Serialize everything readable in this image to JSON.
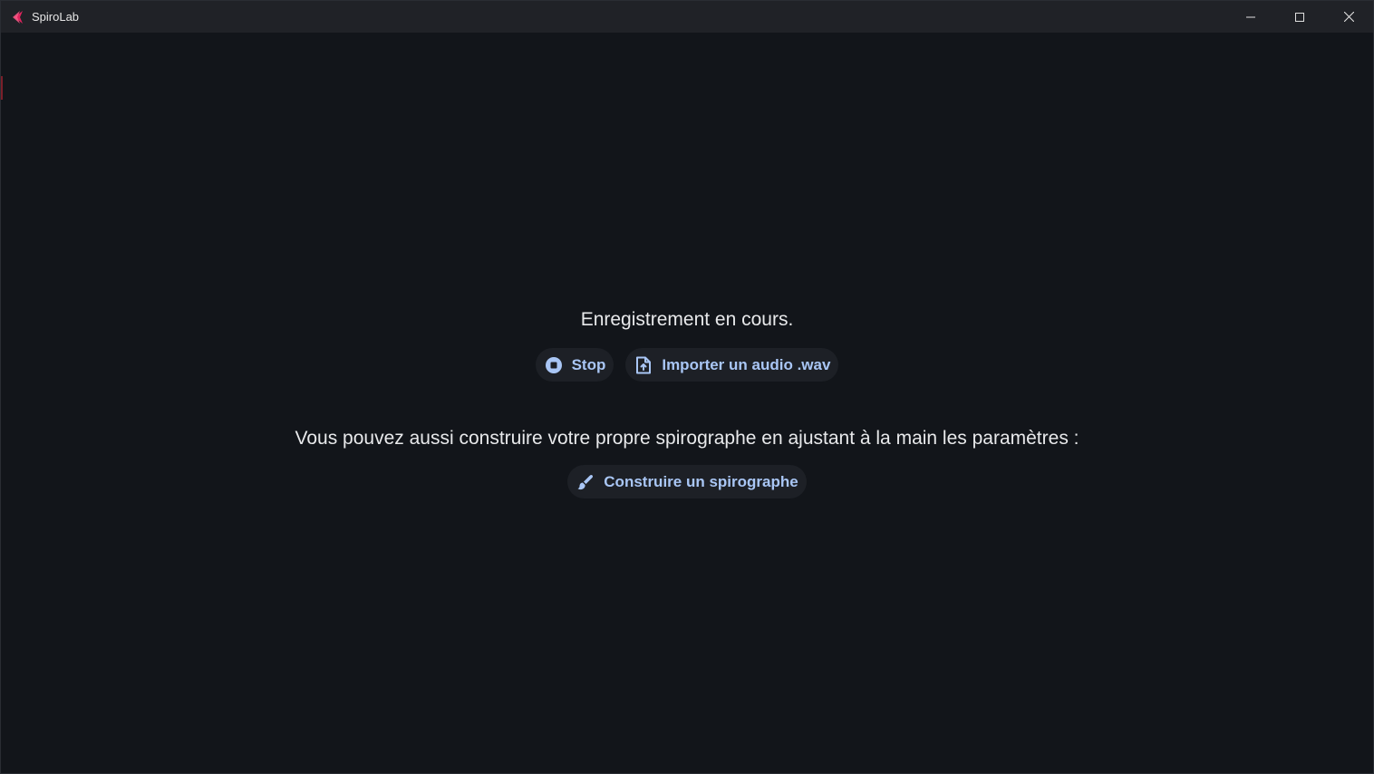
{
  "window": {
    "title": "SpiroLab",
    "app_icon": "spirolab-logo-icon",
    "controls": {
      "minimize": "minimize-icon",
      "maximize": "maximize-icon",
      "close": "close-icon"
    }
  },
  "main": {
    "status_text": "Enregistrement en cours.",
    "stop_button": {
      "label": "Stop",
      "icon": "stop-circle-icon"
    },
    "import_button": {
      "label": "Importer un audio .wav",
      "icon": "file-upload-icon"
    },
    "info_text": "Vous pouvez aussi construire votre propre spirographe en ajustant à la main les paramètres :",
    "build_button": {
      "label": "Construire un spirographe",
      "icon": "brush-icon"
    }
  },
  "colors": {
    "background": "#12151a",
    "titlebar": "#202227",
    "accent": "#a9c6f5",
    "button_bg": "#1d2026",
    "logo": "#e0245e"
  }
}
